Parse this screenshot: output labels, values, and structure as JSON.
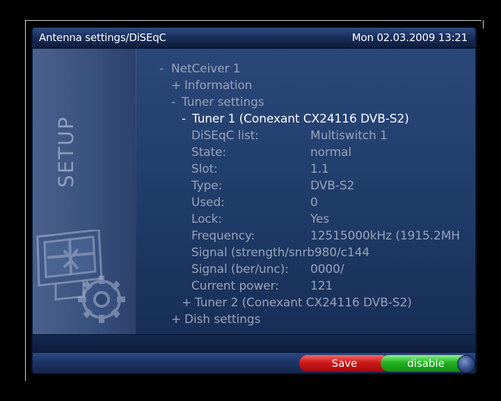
{
  "header": {
    "title": "Antenna settings/DiSEqC",
    "clock": "Mon 02.03.2009 13:21"
  },
  "sidebar": {
    "label": "SETUP",
    "graphic_icon": "setup-monitor-gear-icon"
  },
  "tree": {
    "root": {
      "prefix": "-",
      "label": "NetCeiver 1"
    },
    "information": {
      "prefix": "+",
      "label": "Information"
    },
    "tuner_settings": {
      "prefix": "-",
      "label": "Tuner settings"
    },
    "tuner1": {
      "prefix": "-",
      "label": "Tuner 1 (Conexant CX24116 DVB-S2)"
    },
    "tuner1_fields": [
      {
        "key": "DiSEqC list:",
        "value": "Multiswitch 1"
      },
      {
        "key": "State:",
        "value": "normal"
      },
      {
        "key": "Slot:",
        "value": "1.1"
      },
      {
        "key": "Type:",
        "value": "DVB-S2"
      },
      {
        "key": "Used:",
        "value": "0"
      },
      {
        "key": "Lock:",
        "value": "Yes"
      },
      {
        "key": "Frequency:",
        "value": "12515000kHz (1915.2MH"
      },
      {
        "key": "Signal (strength/snrb980/c144",
        "value": ""
      },
      {
        "key": "Signal (ber/unc):",
        "value": "0000/"
      },
      {
        "key": "Current power:",
        "value": "121"
      }
    ],
    "tuner2": {
      "prefix": "+",
      "label": "Tuner 2 (Conexant CX24116 DVB-S2)"
    },
    "dish_settings": {
      "prefix": "+",
      "label": "Dish settings"
    }
  },
  "footer": {
    "save_label": "Save",
    "disable_label": "disable"
  },
  "colors": {
    "text_dim": "#9aa3b8",
    "text_selected": "#ffffff",
    "save_button": "#d01818",
    "disable_button": "#22b322"
  }
}
